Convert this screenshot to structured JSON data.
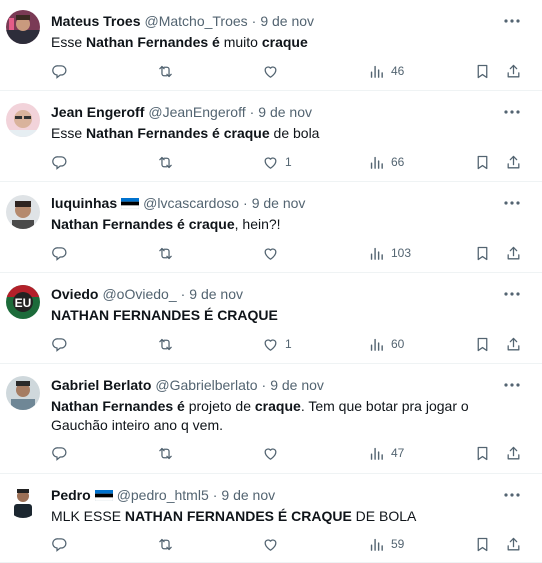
{
  "colors": {
    "secondary": "#536471",
    "text": "#0f1419",
    "divider": "#eff3f4"
  },
  "icons": {
    "reply": "reply-icon",
    "retweet": "retweet-icon",
    "like": "like-icon",
    "views": "views-icon",
    "bookmark": "bookmark-icon",
    "share": "share-icon",
    "more": "more-icon"
  },
  "tweets": [
    {
      "name": "Mateus Troes",
      "handle": "@Matcho_Troes",
      "dot": "·",
      "date": "9 de nov",
      "flag": false,
      "segments": [
        {
          "text": "Esse ",
          "bold": false
        },
        {
          "text": "Nathan Fernandes é",
          "bold": true
        },
        {
          "text": " muito ",
          "bold": false
        },
        {
          "text": "craque",
          "bold": true
        }
      ],
      "likes": "",
      "views": "46"
    },
    {
      "name": "Jean Engeroff",
      "handle": "@JeanEngeroff",
      "dot": "·",
      "date": "9 de nov",
      "flag": false,
      "segments": [
        {
          "text": "Esse ",
          "bold": false
        },
        {
          "text": "Nathan Fernandes é craque",
          "bold": true
        },
        {
          "text": " de bola",
          "bold": false
        }
      ],
      "likes": "1",
      "views": "66"
    },
    {
      "name": "luquinhas",
      "handle": "@lvcascardoso",
      "dot": "·",
      "date": "9 de nov",
      "flag": true,
      "segments": [
        {
          "text": "Nathan Fernandes é craque",
          "bold": true
        },
        {
          "text": ", hein?!",
          "bold": false
        }
      ],
      "likes": "",
      "views": "103"
    },
    {
      "name": "Oviedo",
      "handle": "@oOviedo_",
      "dot": "·",
      "date": "9 de nov",
      "flag": false,
      "segments": [
        {
          "text": "NATHAN FERNANDES É CRAQUE",
          "bold": true
        }
      ],
      "likes": "1",
      "views": "60"
    },
    {
      "name": "Gabriel Berlato",
      "handle": "@Gabrielberlato",
      "dot": "·",
      "date": "9 de nov",
      "flag": false,
      "segments": [
        {
          "text": "Nathan Fernandes é",
          "bold": true
        },
        {
          "text": " projeto de ",
          "bold": false
        },
        {
          "text": "craque",
          "bold": true
        },
        {
          "text": ". Tem que botar pra jogar o Gauchão inteiro ano q vem.",
          "bold": false
        }
      ],
      "likes": "",
      "views": "47"
    },
    {
      "name": "Pedro",
      "handle": "@pedro_html5",
      "dot": "·",
      "date": "9 de nov",
      "flag": true,
      "segments": [
        {
          "text": "MLK ESSE ",
          "bold": false
        },
        {
          "text": "NATHAN FERNANDES É CRAQUE",
          "bold": true
        },
        {
          "text": " DE BOLA",
          "bold": false
        }
      ],
      "likes": "",
      "views": "59"
    }
  ]
}
